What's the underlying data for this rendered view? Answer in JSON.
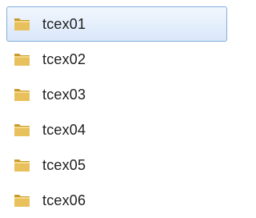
{
  "window": {
    "theme": {
      "selection_border": "#84acdd",
      "selection_fill_top": "#f2f7fd",
      "selection_fill_bottom": "#d9e7fa",
      "folder_color": "#e8c15c",
      "folder_dark": "#c99a2c",
      "text_color": "#1e1e1e"
    }
  },
  "folders": {
    "items": [
      {
        "label": "tcex01",
        "icon": "folder-icon",
        "selected": true
      },
      {
        "label": "tcex02",
        "icon": "folder-icon",
        "selected": false
      },
      {
        "label": "tcex03",
        "icon": "folder-icon",
        "selected": false
      },
      {
        "label": "tcex04",
        "icon": "folder-icon",
        "selected": false
      },
      {
        "label": "tcex05",
        "icon": "folder-icon",
        "selected": false
      },
      {
        "label": "tcex06",
        "icon": "folder-icon",
        "selected": false
      }
    ]
  }
}
